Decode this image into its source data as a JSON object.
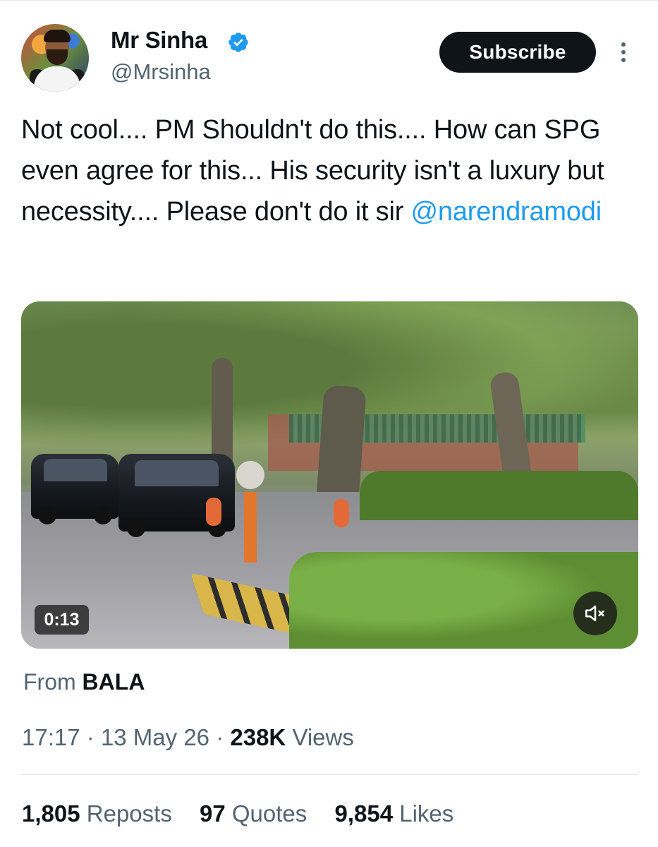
{
  "author": {
    "display_name": "Mr Sinha",
    "handle": "@Mrsinha",
    "verified_icon": "verified-badge-icon",
    "badge_color": "#1d9bf0"
  },
  "header": {
    "subscribe_label": "Subscribe",
    "more_icon": "more-vertical-icon"
  },
  "tweet": {
    "text": "Not cool.... PM Shouldn't do this....  How can SPG even agree for this... His security isn't a luxury but necessity.... Please don't do it sir ",
    "mention": "@narendramodi",
    "mention_color": "#1d9bf0"
  },
  "media": {
    "type": "video",
    "duration": "0:13",
    "mute_icon": "muted-speaker-icon"
  },
  "source": {
    "prefix": "From",
    "name": "BALA"
  },
  "meta": {
    "time": "17:17",
    "sep1": "·",
    "date": "13 May 26",
    "sep2": "·",
    "views_count": "238K",
    "views_label": "Views"
  },
  "stats": [
    {
      "count": "1,805",
      "label": "Reposts"
    },
    {
      "count": "97",
      "label": "Quotes"
    },
    {
      "count": "9,854",
      "label": "Likes"
    }
  ]
}
